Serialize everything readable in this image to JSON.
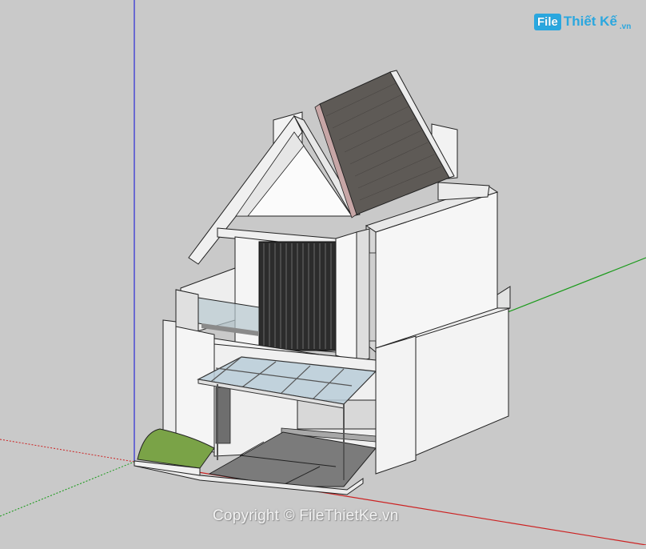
{
  "viewport": {
    "background": "#c9c9c9",
    "axes": {
      "blue_axis": "#2a2ad6",
      "red_axis": "#cc2222",
      "green_axis": "#1a9a1a"
    },
    "model": "two-story townhouse with gabled tile roof, balcony, glass canopy carport"
  },
  "logo": {
    "box_text": "File",
    "brand_text": "Thiết Kế",
    "domain_text": ".vn"
  },
  "watermark": {
    "text": "Copyright © FileThietKe.vn"
  },
  "colors": {
    "wall_white": "#f4f4f4",
    "wall_shadow": "#dcdcdc",
    "roof_tile": "#5e5a56",
    "slat_dark": "#2c2c2c",
    "glass": "#b9cdd8",
    "floor_grey": "#7b7b7b",
    "grass": "#7aa347"
  }
}
